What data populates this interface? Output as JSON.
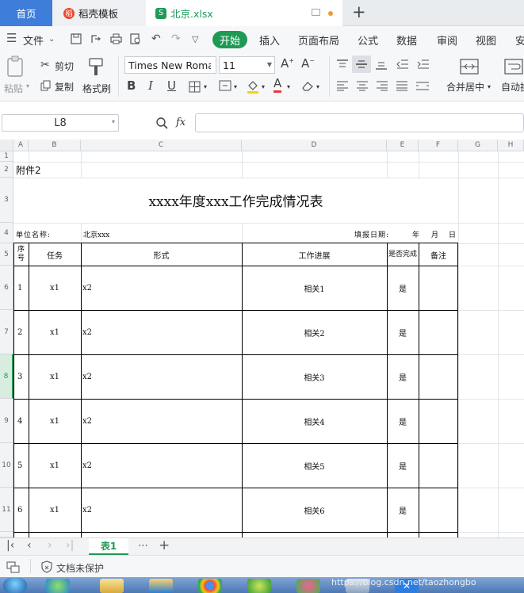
{
  "tabs": {
    "home": "首页",
    "docer": "稻壳模板",
    "doc": "北京.xlsx",
    "new": "+"
  },
  "menu": {
    "file": "文件",
    "start": "开始",
    "items": [
      "插入",
      "页面布局",
      "公式",
      "数据",
      "审阅",
      "视图",
      "安"
    ]
  },
  "ribbon": {
    "paste": "粘贴",
    "cut": "剪切",
    "copy": "复制",
    "format_painter": "格式刷",
    "font_name": "Times New Roman",
    "font_size": "11",
    "merge_center": "合并居中",
    "auto_wrap": "自动换"
  },
  "formula_bar": {
    "cell_ref": "L8",
    "fx": "fx",
    "value": ""
  },
  "columns": [
    "A",
    "B",
    "C",
    "D",
    "E",
    "F",
    "G",
    "H"
  ],
  "rows": [
    "1",
    "2",
    "3",
    "4",
    "5",
    "6",
    "7",
    "8",
    "9",
    "10",
    "11"
  ],
  "sheet": {
    "attachment": "附件2",
    "title": "xxxx年度xxx工作完成情况表",
    "unit_label": "单位名称:",
    "unit_value": "北京xxx",
    "date_label": "填报日期:",
    "date_year": "年",
    "date_month": "月",
    "date_day": "日",
    "headers": [
      "序号",
      "任务",
      "形式",
      "工作进展",
      "是否完成",
      "备注"
    ],
    "data_rows": [
      {
        "no": "1",
        "task": "x1",
        "form": "x2",
        "progress": "相关1",
        "done": "是"
      },
      {
        "no": "2",
        "task": "x1",
        "form": "x2",
        "progress": "相关2",
        "done": "是"
      },
      {
        "no": "3",
        "task": "x1",
        "form": "x2",
        "progress": "相关3",
        "done": "是"
      },
      {
        "no": "4",
        "task": "x1",
        "form": "x2",
        "progress": "相关4",
        "done": "是"
      },
      {
        "no": "5",
        "task": "x1",
        "form": "x2",
        "progress": "相关5",
        "done": "是"
      },
      {
        "no": "6",
        "task": "x1",
        "form": "x2",
        "progress": "相关6",
        "done": "是"
      }
    ]
  },
  "sheet_tab": "表1",
  "status": {
    "protect": "文档未保护"
  },
  "watermark": "https://blog.csdn.net/taozhongbo",
  "colors": {
    "accent": "#1f9a55",
    "home_tab": "#3e7dd9",
    "selected_row": "#d8ecdf"
  }
}
